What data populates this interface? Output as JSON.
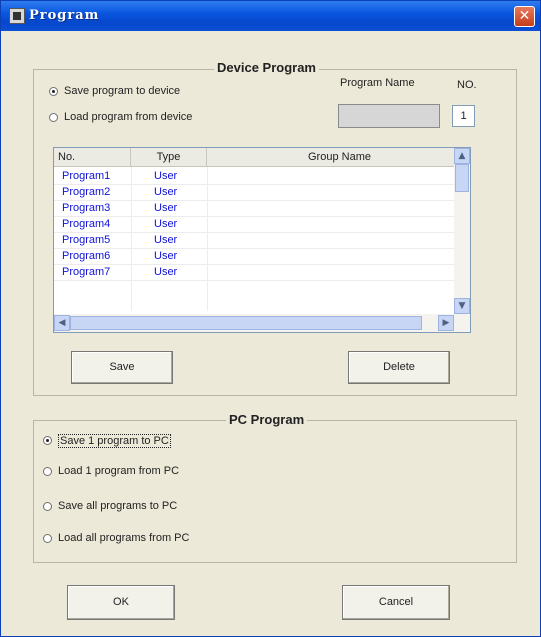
{
  "window": {
    "title": "Program",
    "close_glyph": "✕"
  },
  "device_program": {
    "title": "Device Program",
    "radio_save": "Save program to device",
    "radio_load": "Load program from device",
    "program_name_label": "Program Name",
    "program_name_value": "",
    "no_label": "NO.",
    "no_value": "1",
    "table": {
      "headers": [
        "No.",
        "Type",
        "Group Name"
      ],
      "rows": [
        [
          "Program1",
          "User",
          ""
        ],
        [
          "Program2",
          "User",
          ""
        ],
        [
          "Program3",
          "User",
          ""
        ],
        [
          "Program4",
          "User",
          ""
        ],
        [
          "Program5",
          "User",
          ""
        ],
        [
          "Program6",
          "User",
          ""
        ],
        [
          "Program7",
          "User",
          ""
        ]
      ]
    },
    "save_button": "Save",
    "delete_button": "Delete"
  },
  "pc_program": {
    "title": "PC Program",
    "option1": "Save 1 program to PC",
    "option2": "Load 1 program from PC",
    "option3": "Save all programs to PC",
    "option4": "Load all programs from PC"
  },
  "footer": {
    "ok_button": "OK",
    "cancel_button": "Cancel"
  },
  "scroll_glyphs": {
    "up": "▲",
    "down": "▼",
    "left": "◀",
    "right": "▶"
  }
}
